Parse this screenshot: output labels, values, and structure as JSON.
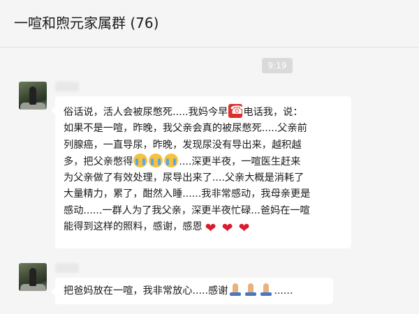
{
  "header": {
    "title": "一喧和煦元家属群 (76)"
  },
  "timestamp": "9:19",
  "messages": [
    {
      "lines": [
        {
          "a": "俗话说，活人会被尿憋死.....我妈今早",
          "icon": "telephone-icon",
          "b": "电话我，说："
        },
        {
          "text": "如果不是一喧，昨晚，我父亲会真的被尿憋死.....父亲前"
        },
        {
          "text": "列腺癌，一直导尿，昨晚，发现尿没有导出来，越积越"
        },
        {
          "a": "多，把父亲憋得",
          "icons": [
            "crying-face-icon",
            "crying-face-icon",
            "crying-face-icon"
          ],
          "b": "....深更半夜，一喧医生赶来"
        },
        {
          "text": "为父亲做了有效处理，尿导出来了....父亲大概是消耗了"
        },
        {
          "text": "大量精力，累了，酣然入睡......我非常感动，我母亲更是"
        },
        {
          "text": "感动......一群人为了我父亲，深更半夜忙碌...爸妈在一喧"
        },
        {
          "a": "能得到这样的照料，感谢，感恩",
          "icons": [
            "heart-icon",
            "heart-icon",
            "heart-icon"
          ]
        }
      ]
    },
    {
      "a": "把爸妈放在一喧，我非常放心.....感谢",
      "icons": [
        "praying-hands-icon",
        "praying-hands-icon",
        "praying-hands-icon"
      ],
      "b": "......"
    }
  ]
}
